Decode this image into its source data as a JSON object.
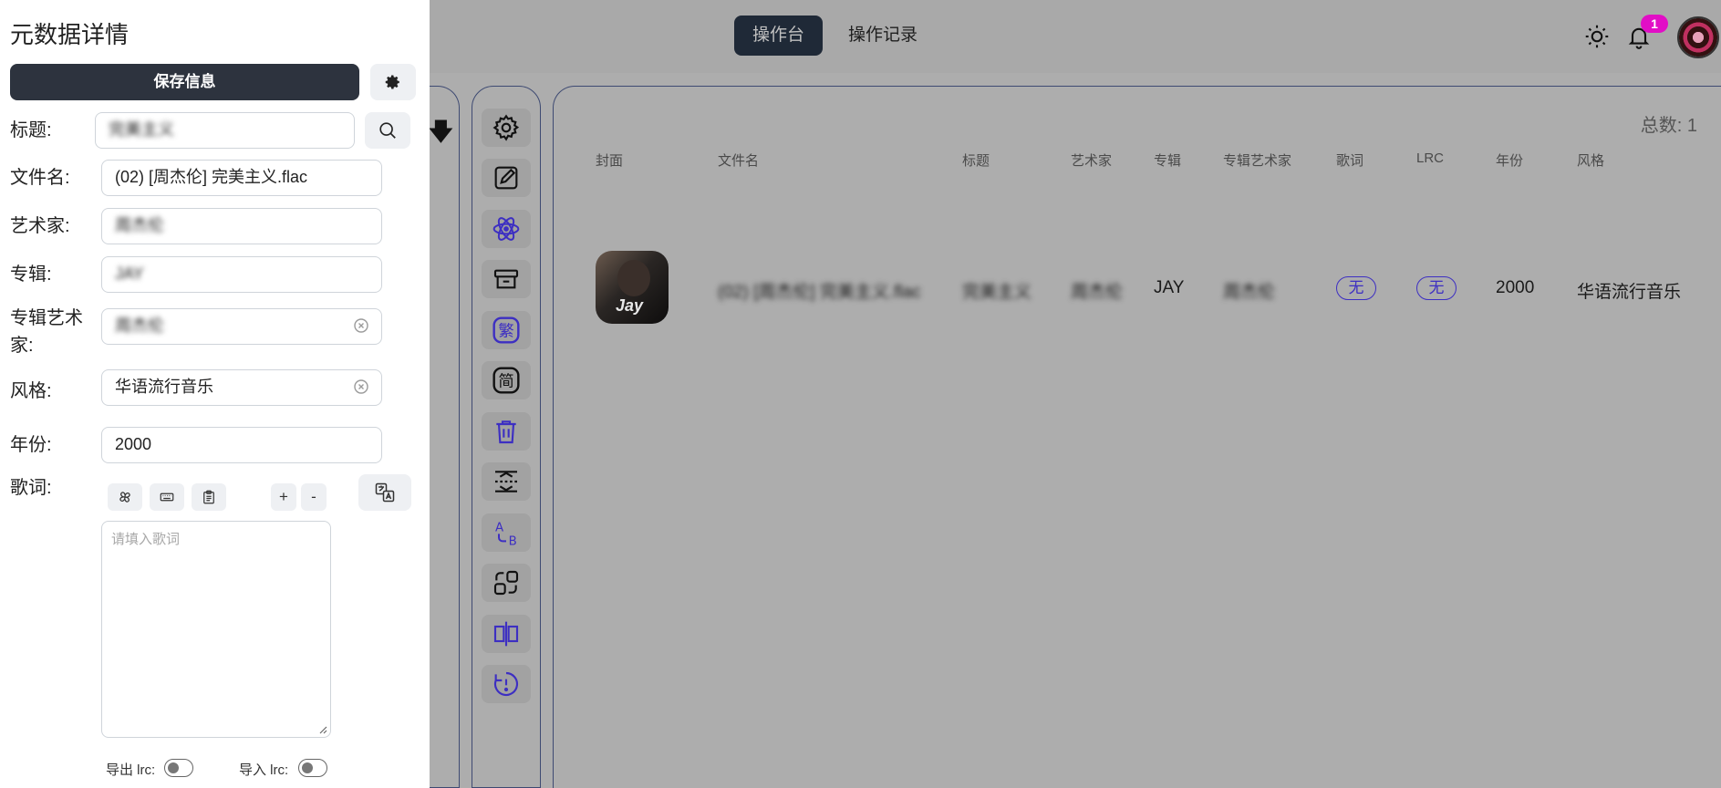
{
  "header": {
    "tabs": [
      {
        "label": "操作台",
        "active": true
      },
      {
        "label": "操作记录",
        "active": false
      }
    ],
    "notification_count": "1"
  },
  "drawer": {
    "title": "元数据详情",
    "save_label": "保存信息",
    "fields": {
      "title": {
        "label": "标题:",
        "value": "完美主义"
      },
      "filename": {
        "label": "文件名:",
        "value": "(02) [周杰伦] 完美主义.flac"
      },
      "artist": {
        "label": "艺术家:",
        "value": "周杰伦"
      },
      "album": {
        "label": "专辑:",
        "value": "JAY"
      },
      "album_artist": {
        "label": "专辑艺术家:",
        "value": "周杰伦"
      },
      "genre": {
        "label": "风格:",
        "value": "华语流行音乐"
      },
      "year": {
        "label": "年份:",
        "value": "2000"
      },
      "lyrics": {
        "label": "歌词:",
        "placeholder": "请填入歌词"
      }
    },
    "lyrics_tools": {
      "plus": "+",
      "minus": "-"
    },
    "export_lrc_label": "导出 lrc:",
    "import_lrc_label": "导入 lrc:"
  },
  "main": {
    "total_label": "总数: 1",
    "columns": [
      "封面",
      "文件名",
      "标题",
      "艺术家",
      "专辑",
      "专辑艺术家",
      "歌词",
      "LRC",
      "年份",
      "风格"
    ],
    "rows": [
      {
        "cover_text": "Jay",
        "filename": "(02) [周杰伦] 完美主义.flac",
        "title": "完美主义",
        "artist": "周杰伦",
        "album": "JAY",
        "album_artist": "周杰伦",
        "lyrics": "无",
        "lrc": "无",
        "year": "2000",
        "genre": "华语流行音乐"
      }
    ]
  },
  "colors": {
    "accent": "#3d2fc2",
    "badge": "#e20ec6",
    "dark": "#2d333e"
  },
  "toolbar_icons": [
    "gear-icon",
    "edit-icon",
    "atom-icon",
    "archive-icon",
    "traditional-chinese-icon",
    "simplified-chinese-icon",
    "trash-icon",
    "spacing-icon",
    "ab-swap-icon",
    "convert-icon",
    "split-icon",
    "alert-icon"
  ]
}
